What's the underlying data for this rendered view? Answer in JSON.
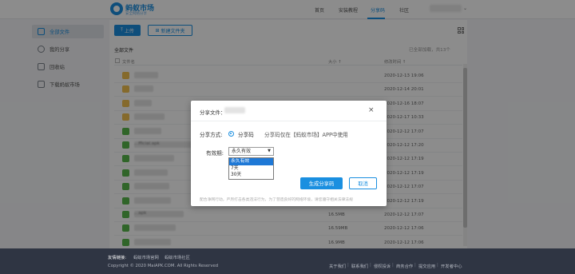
{
  "header": {
    "logo_text": "蚂蚁市场",
    "logo_sub": "安全网络分享",
    "nav": [
      "首页",
      "安装教程",
      "分享码",
      "社区"
    ],
    "active_nav": "分享码"
  },
  "sidebar": {
    "items": [
      {
        "label": "全部文件",
        "icon": "folder-icon",
        "active": true
      },
      {
        "label": "我的分享",
        "icon": "share-icon",
        "active": false
      },
      {
        "label": "回收站",
        "icon": "trash-icon",
        "active": false
      },
      {
        "label": "下载蚂蚁市场",
        "icon": "download-icon",
        "active": false
      }
    ]
  },
  "toolbar": {
    "upload_label": "上传",
    "new_folder_label": "新建文件夹"
  },
  "breadcrumb": "全部文件",
  "loaded_text": "已全部加载，共13个",
  "table": {
    "headers": {
      "name": "文件名",
      "size": "大小 ↑",
      "date": "修改时间 ↑"
    },
    "rows": [
      {
        "type": "folder",
        "name": "",
        "size": "",
        "date": "2020-12-13 19:06"
      },
      {
        "type": "folder",
        "name": "",
        "size": "",
        "date": "2020-12-14 20:01"
      },
      {
        "type": "folder",
        "name": "",
        "size": "",
        "date": "2020-12-16 18:07"
      },
      {
        "type": "folder",
        "name": "",
        "size": "",
        "date": "2020-12-17 10:33"
      },
      {
        "type": "apk",
        "name": "",
        "size": "",
        "date": "2020-12-12 17:07"
      },
      {
        "type": "apk",
        "name": "...fficial.apk",
        "size": "",
        "date": "2020-12-12 17:20"
      },
      {
        "type": "apk",
        "name": "",
        "size": "",
        "date": "2020-12-12 17:19"
      },
      {
        "type": "apk",
        "name": "",
        "size": "",
        "date": "2020-12-12 17:19"
      },
      {
        "type": "apk",
        "name": "",
        "size": "",
        "date": "2020-12-12 17:07"
      },
      {
        "type": "apk",
        "name": "",
        "size": "",
        "date": "2020-12-12 17:19"
      },
      {
        "type": "apk",
        "name": "...apk",
        "size": "16.5MB",
        "date": "2020-12-12 17:07"
      },
      {
        "type": "apk",
        "name": "",
        "size": "16.59MB",
        "date": "2020-12-12 17:06"
      },
      {
        "type": "apk",
        "name": "",
        "size": "16.9MB",
        "date": "2020-12-12 17:06"
      }
    ]
  },
  "modal": {
    "title": "分享文件：",
    "close": "×",
    "share_method_label": "分享方式:",
    "share_option": "分享码",
    "share_note": "分享码仅在【蚂蚁市场】APP中使用",
    "validity_label": "有效期:",
    "validity_selected": "永久有效",
    "validity_options": [
      "永久有效",
      "7天",
      "30天"
    ],
    "generate_label": "生成分享码",
    "cancel_label": "取消",
    "notice": "配合净网行动，严厉打击各类违法行为，为了营造良好的网络环境，请您遵守相关法律法规"
  },
  "footer": {
    "links_title": "友情链接:",
    "links": [
      "蚂蚁市场官网",
      "蚂蚁市场社区"
    ],
    "copyright": "Copyright © 2020 MaiAPK.COM. All Rights Reserved",
    "right_links": [
      "关于我们",
      "联系我们",
      "侵权投诉",
      "商务合作",
      "提交应用",
      "开发者中心"
    ]
  },
  "colors": {
    "accent": "#1a8fe0",
    "footer_bg": "#2f3543",
    "folder": "#f2c250",
    "apk": "#58b84b"
  }
}
